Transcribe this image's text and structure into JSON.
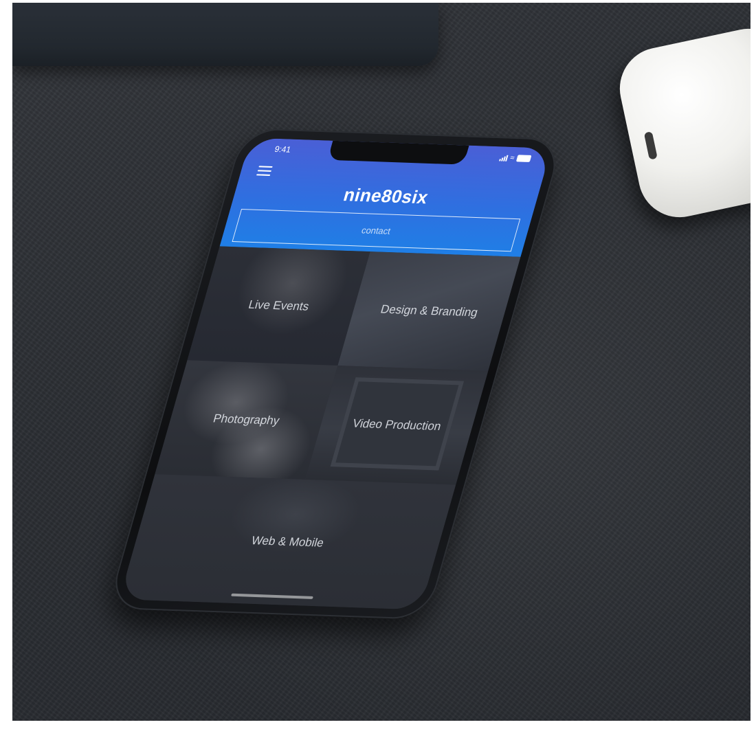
{
  "status": {
    "time": "9:41"
  },
  "header": {
    "brand": "nine80six",
    "contact_label": "contact"
  },
  "tiles": [
    {
      "label": "Live Events"
    },
    {
      "label": "Design & Branding"
    },
    {
      "label": "Photography"
    },
    {
      "label": "Video Production"
    },
    {
      "label": "Web & Mobile"
    }
  ],
  "colors": {
    "header_top": "#4a5fd6",
    "header_bottom": "#1f7fe6",
    "tile_overlay": "#2d3038"
  },
  "icons": [
    "menu-icon",
    "signal-icon",
    "wifi-icon",
    "battery-icon"
  ]
}
